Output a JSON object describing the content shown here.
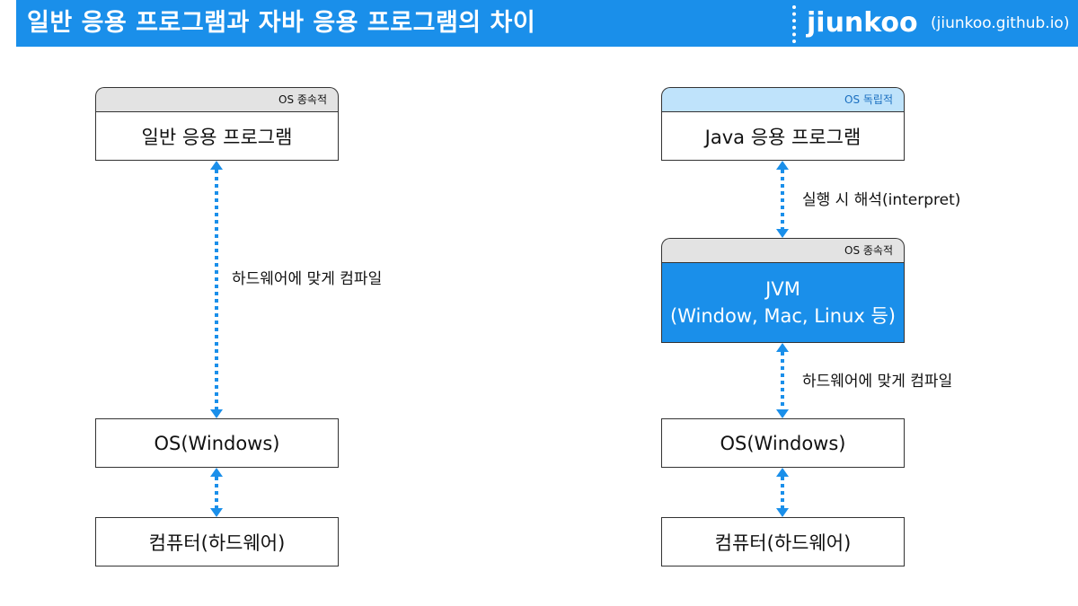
{
  "header": {
    "title": "일반 응용 프로그램과 자바 응용 프로그램의 차이",
    "brand": "jiunkoo",
    "brand_url": "(jiunkoo.github.io)"
  },
  "left": {
    "tab": "OS 종속적",
    "app_box": "일반 응용 프로그램",
    "arrow1_label": "하드웨어에 맞게 컴파일",
    "os_box": "OS(Windows)",
    "hw_box": "컴퓨터(하드웨어)"
  },
  "right": {
    "tab_top": "OS 독립적",
    "app_box": "Java 응용 프로그램",
    "arrow1_label": "실행 시 해석(interpret)",
    "tab_jvm": "OS 종속적",
    "jvm_title": "JVM",
    "jvm_subtitle": "(Window, Mac, Linux 등)",
    "arrow2_label": "하드웨어에 맞게 컴파일",
    "os_box": "OS(Windows)",
    "hw_box": "컴퓨터(하드웨어)"
  },
  "colors": {
    "accent": "#1a8fea",
    "tab_gray": "#e3e3e3",
    "tab_blue": "#bfe3fb"
  }
}
